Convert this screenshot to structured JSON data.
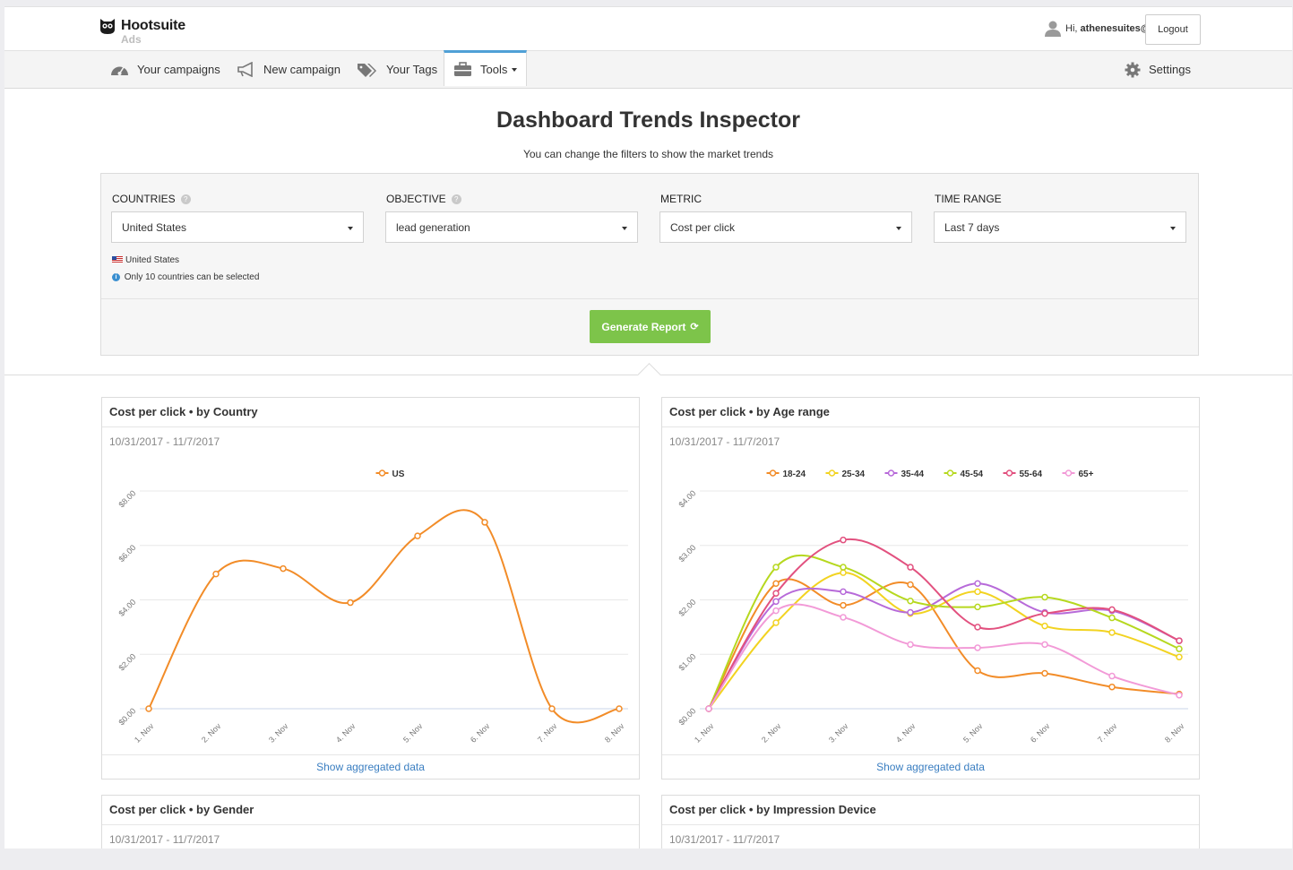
{
  "header": {
    "brand": "Hootsuite",
    "brand_sub": "Ads",
    "user_greeting": "Hi, ",
    "user_name": "athenesuites@!",
    "logout_label": "Logout"
  },
  "nav": {
    "campaigns": "Your campaigns",
    "new_campaign": "New campaign",
    "tags": "Your Tags",
    "tools": "Tools",
    "settings": "Settings"
  },
  "page": {
    "title": "Dashboard Trends Inspector",
    "subtitle": "You can change the filters to show the market trends"
  },
  "filters": {
    "countries_label": "COUNTRIES",
    "countries_value": "United States",
    "countries_selected": "United States",
    "countries_note": "Only 10 countries can be selected",
    "objective_label": "OBJECTIVE",
    "objective_value": "lead generation",
    "metric_label": "METRIC",
    "metric_value": "Cost per click",
    "time_label": "TIME RANGE",
    "time_value": "Last 7 days",
    "generate_label": "Generate Report"
  },
  "panels": {
    "country": {
      "title": "Cost per click • by Country",
      "date": "10/31/2017 - 11/7/2017",
      "footer": "Show aggregated data"
    },
    "age": {
      "title": "Cost per click • by Age range",
      "date": "10/31/2017 - 11/7/2017",
      "footer": "Show aggregated data"
    },
    "gender": {
      "title": "Cost per click • by Gender",
      "date": "10/31/2017 - 11/7/2017"
    },
    "device": {
      "title": "Cost per click • by Impression Device",
      "date": "10/31/2017 - 11/7/2017"
    }
  },
  "colors": {
    "accent": "#4fa0d6",
    "green": "#7dc44a",
    "link": "#3a7ec1"
  },
  "chart_data": [
    {
      "type": "line",
      "x": [
        "1. Nov",
        "2. Nov",
        "3. Nov",
        "4. Nov",
        "5. Nov",
        "6. Nov",
        "7. Nov",
        "8. Nov"
      ],
      "yticks": [
        "$0.00",
        "$2.00",
        "$4.00",
        "$6.00",
        "$8.00"
      ],
      "ylim": [
        0,
        8
      ],
      "legend": "top-center",
      "series": [
        {
          "name": "US",
          "color": "#f28c28",
          "values": [
            0,
            4.95,
            5.15,
            3.9,
            6.35,
            6.85,
            0,
            0
          ]
        }
      ]
    },
    {
      "type": "line",
      "x": [
        "1. Nov",
        "2. Nov",
        "3. Nov",
        "4. Nov",
        "5. Nov",
        "6. Nov",
        "7. Nov",
        "8. Nov"
      ],
      "yticks": [
        "$0.00",
        "$1.00",
        "$2.00",
        "$3.00",
        "$4.00"
      ],
      "ylim": [
        0,
        4
      ],
      "legend": "top-center",
      "series": [
        {
          "name": "18-24",
          "color": "#f28c28",
          "values": [
            0,
            2.3,
            1.9,
            2.28,
            0.7,
            0.65,
            0.4,
            0.27
          ]
        },
        {
          "name": "25-34",
          "color": "#f2d321",
          "values": [
            0,
            1.58,
            2.5,
            1.75,
            2.15,
            1.52,
            1.4,
            0.95
          ]
        },
        {
          "name": "35-44",
          "color": "#b76ad9",
          "values": [
            0,
            1.97,
            2.15,
            1.77,
            2.3,
            1.77,
            1.8,
            1.25
          ]
        },
        {
          "name": "45-54",
          "color": "#b6d81f",
          "values": [
            0,
            2.6,
            2.6,
            1.98,
            1.87,
            2.05,
            1.67,
            1.1
          ]
        },
        {
          "name": "55-64",
          "color": "#e2517f",
          "values": [
            0,
            2.12,
            3.1,
            2.6,
            1.5,
            1.75,
            1.82,
            1.25
          ]
        },
        {
          "name": "65+",
          "color": "#f29ad7",
          "values": [
            0,
            1.8,
            1.68,
            1.18,
            1.12,
            1.18,
            0.6,
            0.25
          ]
        }
      ]
    }
  ]
}
